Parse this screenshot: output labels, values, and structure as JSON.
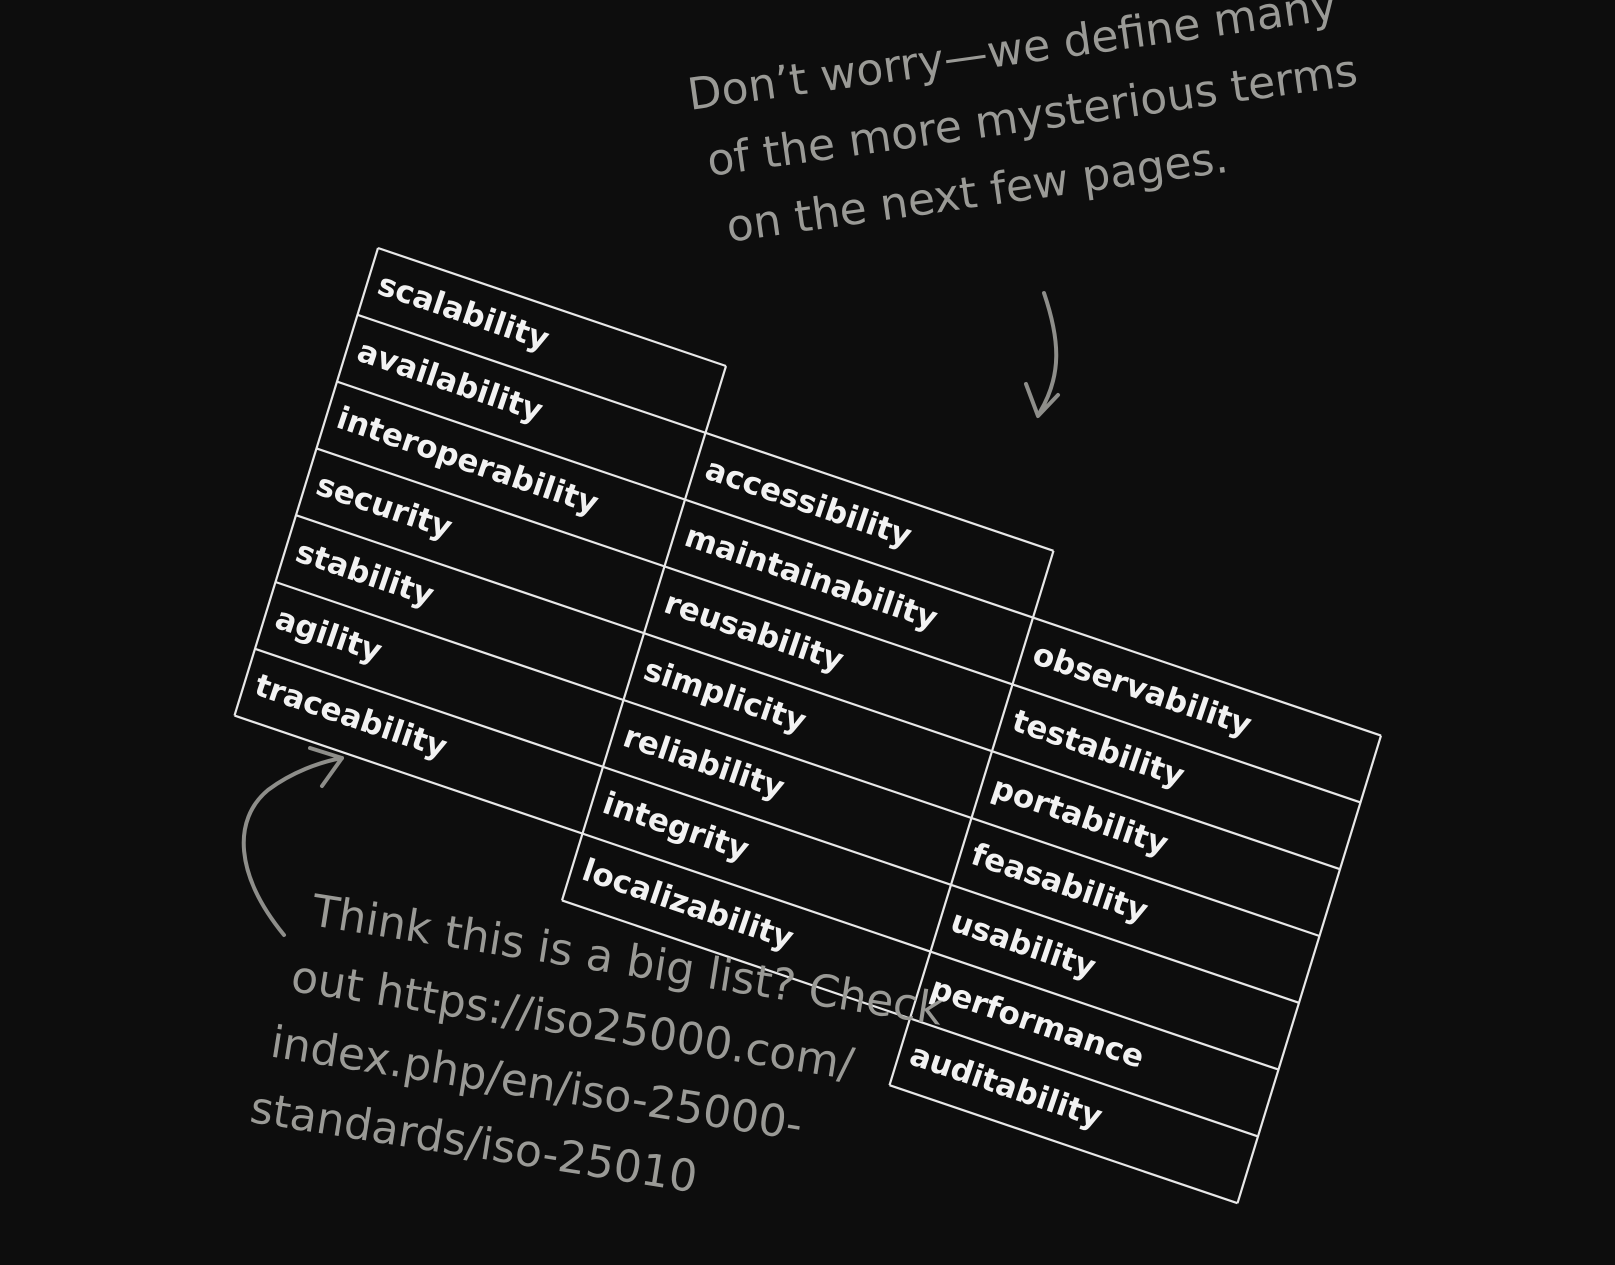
{
  "top_note": {
    "lines": [
      "Don’t worry—we define many",
      "of the more mysterious terms",
      "on the next few pages."
    ]
  },
  "bottom_note": {
    "lines": [
      "Think this is a big list? Check",
      "out https://iso25000.com/",
      "index.php/en/iso-25000-",
      "standards/iso-25010"
    ]
  },
  "terms_table": {
    "columns": [
      {
        "items": [
          "scalability",
          "availability",
          "interoperability",
          "security",
          "stability",
          "agility",
          "traceability"
        ]
      },
      {
        "items": [
          "accessibility",
          "maintainability",
          "reusability",
          "simplicity",
          "reliability",
          "integrity",
          "localizability"
        ]
      },
      {
        "items": [
          "observability",
          "testability",
          "portability",
          "feasability",
          "usability",
          "performance",
          "auditability"
        ]
      }
    ]
  },
  "colors": {
    "background": "#0d0d0d",
    "grid": "#e8e8e8",
    "cell_text": "#f2f2f2",
    "note_text": "#9a9a96"
  }
}
